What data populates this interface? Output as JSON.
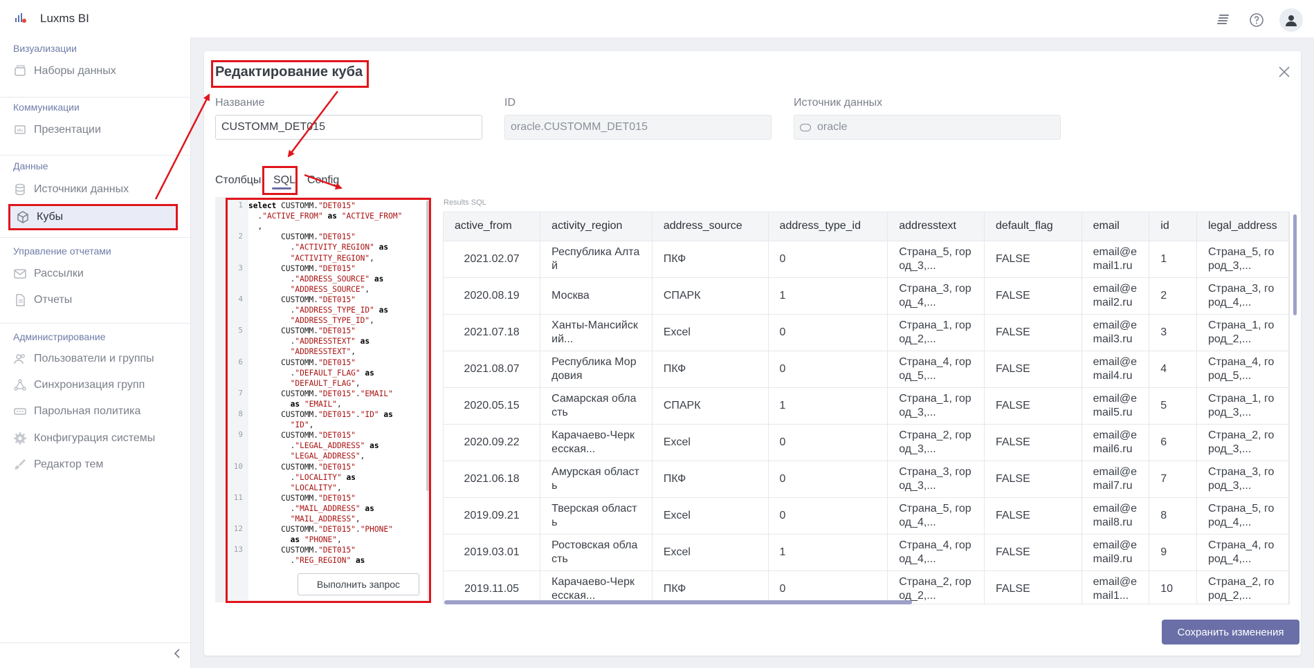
{
  "app": {
    "title": "Luxms BI"
  },
  "sidebar": {
    "sections": [
      {
        "title": "Визуализации",
        "items": [
          {
            "label": "Наборы данных",
            "icon": "datasets-icon"
          }
        ]
      },
      {
        "title": "Коммуникации",
        "items": [
          {
            "label": "Презентации",
            "icon": "presentation-icon"
          }
        ]
      },
      {
        "title": "Данные",
        "items": [
          {
            "label": "Источники данных",
            "icon": "database-icon"
          },
          {
            "label": "Кубы",
            "icon": "cube-icon",
            "active": true
          }
        ]
      },
      {
        "title": "Управление отчетами",
        "items": [
          {
            "label": "Рассылки",
            "icon": "mail-icon"
          },
          {
            "label": "Отчеты",
            "icon": "report-icon"
          }
        ]
      },
      {
        "title": "Администрирование",
        "items": [
          {
            "label": "Пользователи и группы",
            "icon": "users-icon"
          },
          {
            "label": "Синхронизация групп",
            "icon": "sync-icon"
          },
          {
            "label": "Парольная политика",
            "icon": "password-icon"
          },
          {
            "label": "Конфигурация системы",
            "icon": "gear-icon"
          },
          {
            "label": "Редактор тем",
            "icon": "brush-icon"
          }
        ]
      }
    ]
  },
  "modal": {
    "title": "Редактирование куба",
    "fields": {
      "name_label": "Название",
      "name_value": "CUSTOMM_DET015",
      "id_label": "ID",
      "id_value": "oracle.CUSTOMM_DET015",
      "source_label": "Источник данных",
      "source_value": "oracle"
    },
    "tabs": [
      "Столбцы",
      "SQL",
      "Config"
    ],
    "active_tab": "SQL",
    "run_button": "Выполнить запрос",
    "results_label": "Results SQL",
    "save_button": "Сохранить изменения"
  },
  "sql_lines": [
    {
      "n": "1",
      "rows": [
        [
          [
            "kw",
            "select"
          ],
          [
            "t",
            " CUSTOMM."
          ],
          [
            "str",
            "\"DET015\""
          ]
        ],
        [
          [
            "t",
            "  ."
          ],
          [
            "str",
            "\"ACTIVE_FROM\""
          ],
          [
            "t",
            " "
          ],
          [
            "kw",
            "as"
          ],
          [
            "t",
            " "
          ],
          [
            "str",
            "\"ACTIVE_FROM\""
          ]
        ],
        [
          [
            "t",
            "  ,"
          ]
        ]
      ]
    },
    {
      "n": "2",
      "rows": [
        [
          [
            "t",
            "       CUSTOMM."
          ],
          [
            "str",
            "\"DET015\""
          ]
        ],
        [
          [
            "t",
            "         ."
          ],
          [
            "str",
            "\"ACTIVITY_REGION\""
          ],
          [
            "t",
            " "
          ],
          [
            "kw",
            "as"
          ]
        ],
        [
          [
            "t",
            "         "
          ],
          [
            "str",
            "\"ACTIVITY_REGION\""
          ],
          [
            "t",
            ","
          ]
        ]
      ]
    },
    {
      "n": "3",
      "rows": [
        [
          [
            "t",
            "       CUSTOMM."
          ],
          [
            "str",
            "\"DET015\""
          ]
        ],
        [
          [
            "t",
            "         ."
          ],
          [
            "str",
            "\"ADDRESS_SOURCE\""
          ],
          [
            "t",
            " "
          ],
          [
            "kw",
            "as"
          ]
        ],
        [
          [
            "t",
            "         "
          ],
          [
            "str",
            "\"ADDRESS_SOURCE\""
          ],
          [
            "t",
            ","
          ]
        ]
      ]
    },
    {
      "n": "4",
      "rows": [
        [
          [
            "t",
            "       CUSTOMM."
          ],
          [
            "str",
            "\"DET015\""
          ]
        ],
        [
          [
            "t",
            "         ."
          ],
          [
            "str",
            "\"ADDRESS_TYPE_ID\""
          ],
          [
            "t",
            " "
          ],
          [
            "kw",
            "as"
          ]
        ],
        [
          [
            "t",
            "         "
          ],
          [
            "str",
            "\"ADDRESS_TYPE_ID\""
          ],
          [
            "t",
            ","
          ]
        ]
      ]
    },
    {
      "n": "5",
      "rows": [
        [
          [
            "t",
            "       CUSTOMM."
          ],
          [
            "str",
            "\"DET015\""
          ]
        ],
        [
          [
            "t",
            "         ."
          ],
          [
            "str",
            "\"ADDRESSTEXT\""
          ],
          [
            "t",
            " "
          ],
          [
            "kw",
            "as"
          ]
        ],
        [
          [
            "t",
            "         "
          ],
          [
            "str",
            "\"ADDRESSTEXT\""
          ],
          [
            "t",
            ","
          ]
        ]
      ]
    },
    {
      "n": "6",
      "rows": [
        [
          [
            "t",
            "       CUSTOMM."
          ],
          [
            "str",
            "\"DET015\""
          ]
        ],
        [
          [
            "t",
            "         ."
          ],
          [
            "str",
            "\"DEFAULT_FLAG\""
          ],
          [
            "t",
            " "
          ],
          [
            "kw",
            "as"
          ]
        ],
        [
          [
            "t",
            "         "
          ],
          [
            "str",
            "\"DEFAULT_FLAG\""
          ],
          [
            "t",
            ","
          ]
        ]
      ]
    },
    {
      "n": "7",
      "rows": [
        [
          [
            "t",
            "       CUSTOMM."
          ],
          [
            "str",
            "\"DET015\""
          ],
          [
            "t",
            "."
          ],
          [
            "str",
            "\"EMAIL\""
          ]
        ],
        [
          [
            "t",
            "         "
          ],
          [
            "kw",
            "as"
          ],
          [
            "t",
            " "
          ],
          [
            "str",
            "\"EMAIL\""
          ],
          [
            "t",
            ","
          ]
        ]
      ]
    },
    {
      "n": "8",
      "rows": [
        [
          [
            "t",
            "       CUSTOMM."
          ],
          [
            "str",
            "\"DET015\""
          ],
          [
            "t",
            "."
          ],
          [
            "str",
            "\"ID\""
          ],
          [
            "t",
            " "
          ],
          [
            "kw",
            "as"
          ]
        ],
        [
          [
            "t",
            "         "
          ],
          [
            "str",
            "\"ID\""
          ],
          [
            "t",
            ","
          ]
        ]
      ]
    },
    {
      "n": "9",
      "rows": [
        [
          [
            "t",
            "       CUSTOMM."
          ],
          [
            "str",
            "\"DET015\""
          ]
        ],
        [
          [
            "t",
            "         ."
          ],
          [
            "str",
            "\"LEGAL_ADDRESS\""
          ],
          [
            "t",
            " "
          ],
          [
            "kw",
            "as"
          ]
        ],
        [
          [
            "t",
            "         "
          ],
          [
            "str",
            "\"LEGAL_ADDRESS\""
          ],
          [
            "t",
            ","
          ]
        ]
      ]
    },
    {
      "n": "10",
      "rows": [
        [
          [
            "t",
            "       CUSTOMM."
          ],
          [
            "str",
            "\"DET015\""
          ]
        ],
        [
          [
            "t",
            "         ."
          ],
          [
            "str",
            "\"LOCALITY\""
          ],
          [
            "t",
            " "
          ],
          [
            "kw",
            "as"
          ]
        ],
        [
          [
            "t",
            "         "
          ],
          [
            "str",
            "\"LOCALITY\""
          ],
          [
            "t",
            ","
          ]
        ]
      ]
    },
    {
      "n": "11",
      "rows": [
        [
          [
            "t",
            "       CUSTOMM."
          ],
          [
            "str",
            "\"DET015\""
          ]
        ],
        [
          [
            "t",
            "         ."
          ],
          [
            "str",
            "\"MAIL_ADDRESS\""
          ],
          [
            "t",
            " "
          ],
          [
            "kw",
            "as"
          ]
        ],
        [
          [
            "t",
            "         "
          ],
          [
            "str",
            "\"MAIL_ADDRESS\""
          ],
          [
            "t",
            ","
          ]
        ]
      ]
    },
    {
      "n": "12",
      "rows": [
        [
          [
            "t",
            "       CUSTOMM."
          ],
          [
            "str",
            "\"DET015\""
          ],
          [
            "t",
            "."
          ],
          [
            "str",
            "\"PHONE\""
          ]
        ],
        [
          [
            "t",
            "         "
          ],
          [
            "kw",
            "as"
          ],
          [
            "t",
            " "
          ],
          [
            "str",
            "\"PHONE\""
          ],
          [
            "t",
            ","
          ]
        ]
      ]
    },
    {
      "n": "13",
      "rows": [
        [
          [
            "t",
            "       CUSTOMM."
          ],
          [
            "str",
            "\"DET015\""
          ]
        ],
        [
          [
            "t",
            "         ."
          ],
          [
            "str",
            "\"REG_REGION\""
          ],
          [
            "t",
            " "
          ],
          [
            "kw",
            "as"
          ]
        ]
      ]
    }
  ],
  "results": {
    "columns": [
      "active_from",
      "activity_region",
      "address_source",
      "address_type_id",
      "addresstext",
      "default_flag",
      "email",
      "id",
      "legal_address"
    ],
    "rows": [
      [
        "2021.02.07",
        "Республика Алтай",
        "ПКФ",
        "0",
        "Страна_5, город_3,...",
        "FALSE",
        "email@email1.ru",
        "1",
        "Страна_5, город_3,..."
      ],
      [
        "2020.08.19",
        "Москва",
        "СПАРК",
        "1",
        "Страна_3, город_4,...",
        "FALSE",
        "email@email2.ru",
        "2",
        "Страна_3, город_4,..."
      ],
      [
        "2021.07.18",
        "Ханты-Мансийский...",
        "Excel",
        "0",
        "Страна_1, город_2,...",
        "FALSE",
        "email@email3.ru",
        "3",
        "Страна_1, город_2,..."
      ],
      [
        "2021.08.07",
        "Республика Мордовия",
        "ПКФ",
        "0",
        "Страна_4, город_5,...",
        "FALSE",
        "email@email4.ru",
        "4",
        "Страна_4, город_5,..."
      ],
      [
        "2020.05.15",
        "Самарская область",
        "СПАРК",
        "1",
        "Страна_1, город_3,...",
        "FALSE",
        "email@email5.ru",
        "5",
        "Страна_1, город_3,..."
      ],
      [
        "2020.09.22",
        "Карачаево-Черкесская...",
        "Excel",
        "0",
        "Страна_2, город_3,...",
        "FALSE",
        "email@email6.ru",
        "6",
        "Страна_2, город_3,..."
      ],
      [
        "2021.06.18",
        "Амурская область",
        "ПКФ",
        "0",
        "Страна_3, город_3,...",
        "FALSE",
        "email@email7.ru",
        "7",
        "Страна_3, город_3,..."
      ],
      [
        "2019.09.21",
        "Тверская область",
        "Excel",
        "0",
        "Страна_5, город_4,...",
        "FALSE",
        "email@email8.ru",
        "8",
        "Страна_5, город_4,..."
      ],
      [
        "2019.03.01",
        "Ростовская область",
        "Excel",
        "1",
        "Страна_4, город_4,...",
        "FALSE",
        "email@email9.ru",
        "9",
        "Страна_4, город_4,..."
      ],
      [
        "2019.11.05",
        "Карачаево-Черкесская...",
        "ПКФ",
        "0",
        "Страна_2, город_2,...",
        "FALSE",
        "email@email1...",
        "10",
        "Страна_2, город_2,..."
      ]
    ]
  },
  "colors": {
    "accent": "#6a6fa8",
    "annotation": "#e0151b"
  }
}
